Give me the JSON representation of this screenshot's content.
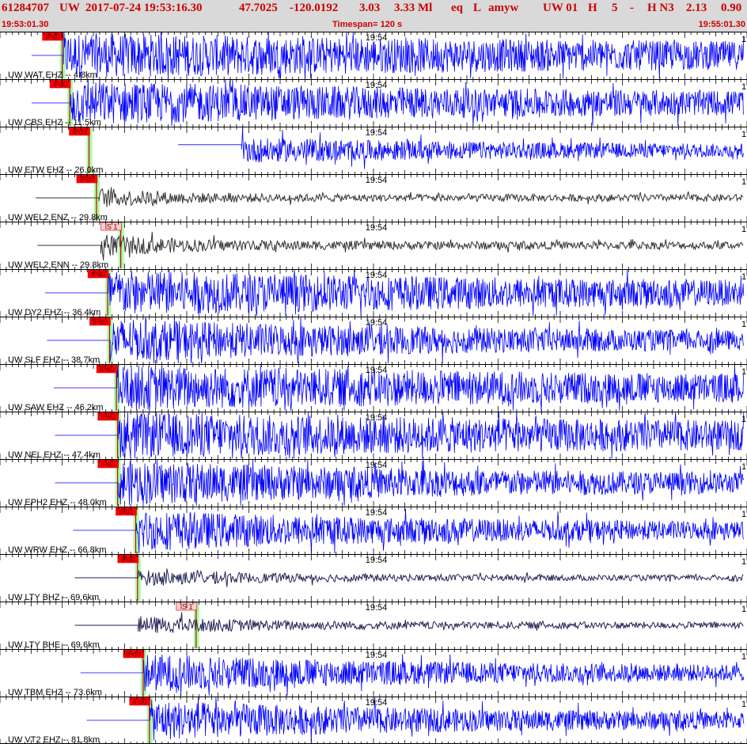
{
  "header": {
    "event_id": "61284707",
    "network": "UW",
    "datetime": "2017-07-24 19:53:16.30",
    "latitude": "47.7025",
    "longitude": "-120.0192",
    "depth": "3.03",
    "magnitude": "3.33 Ml",
    "event_type": "eq",
    "location_flag": "L",
    "analyst": "amyw",
    "solution_source": "UW 01",
    "quality": "H",
    "phase_count": "5",
    "dash": "-",
    "review_code": "H N3",
    "value_a": "2.13",
    "value_b": "0.90",
    "start_time": "19:53:01.30",
    "timespan_label": "Timespan= 120 s",
    "end_time": "19:55:01.30"
  },
  "chart_data": {
    "type": "seismogram",
    "time_start": "19:53:01.30",
    "time_end": "19:55:01.30",
    "timespan_s": 120,
    "minute_marker": "19:54",
    "minute_marker_offset_s": 58.7,
    "scale_label": "1",
    "colors": {
      "trace_blue": "#0000ff",
      "trace_dark": "#333333",
      "trace_navy": "#222255",
      "pick_label_bg": "#ff0000",
      "s_pick_label_bg": "#ffcccc",
      "pick_line": "#cc0000",
      "pick_window": "#99ff99",
      "header_bg": "#d9d9d9",
      "header_text": "#cc0000"
    },
    "channels": [
      {
        "label": "UW WAT EHZ -- 4.8km",
        "color": "blue",
        "onset_s": 10.2,
        "amplitude": 1.0,
        "decay": 0.4,
        "pre_offset": 0.0,
        "picks": [
          {
            "label": "iPd0",
            "time_s": 10.0
          }
        ]
      },
      {
        "label": "UW CBS EHZ -- 11.5km",
        "color": "blue",
        "onset_s": 11.3,
        "amplitude": 0.95,
        "decay": 0.5,
        "pre_offset": 0.0,
        "picks": [
          {
            "label": "iPd0",
            "time_s": 11.2
          }
        ]
      },
      {
        "label": "UW ETW EHZ -- 26.0km",
        "color": "blue",
        "onset_s": 38.8,
        "amplitude": 0.55,
        "decay": 0.6,
        "pre_offset": 0.25,
        "picks": [
          {
            "label": "iPd0",
            "time_s": 14.3
          }
        ]
      },
      {
        "label": "UW WEL2 ENZ -- 29.8km",
        "color": "dark",
        "onset_s": 15.9,
        "amplitude": 0.45,
        "decay": 4.0,
        "pre_offset": 0.0,
        "picks": [
          {
            "label": "iPd0",
            "time_s": 15.5
          }
        ]
      },
      {
        "label": "UW WEL2 ENN -- 29.8km",
        "color": "dark",
        "onset_s": 16.2,
        "amplitude": 0.5,
        "decay": 3.5,
        "pre_offset": 0.0,
        "picks": [
          {
            "label": "iS 1",
            "time_s": 19.4
          }
        ]
      },
      {
        "label": "UW DY2 EHZ -- 36.4km",
        "color": "blue",
        "onset_s": 17.4,
        "amplitude": 1.0,
        "decay": 0.5,
        "pre_offset": 0.0,
        "picks": [
          {
            "label": "iPd0",
            "time_s": 17.3
          }
        ]
      },
      {
        "label": "UW SLF EHZ -- 38.7km",
        "color": "blue",
        "onset_s": 17.7,
        "amplitude": 0.95,
        "decay": 0.8,
        "pre_offset": 0.0,
        "picks": [
          {
            "label": "iPd0",
            "time_s": 17.6
          }
        ]
      },
      {
        "label": "UW SAW EHZ -- 46.2km",
        "color": "blue",
        "onset_s": 18.8,
        "amplitude": 1.0,
        "decay": 0.4,
        "pre_offset": 0.0,
        "picks": [
          {
            "label": "iPd0",
            "time_s": 18.7
          }
        ]
      },
      {
        "label": "UW NEL EHZ -- 47.4km",
        "color": "blue",
        "onset_s": 19.0,
        "amplitude": 1.0,
        "decay": 0.35,
        "pre_offset": 0.0,
        "picks": [
          {
            "label": "iPd0",
            "time_s": 18.9
          }
        ]
      },
      {
        "label": "UW EPH2 EHZ -- 48.0km",
        "color": "blue",
        "onset_s": 19.0,
        "amplitude": 1.0,
        "decay": 0.8,
        "pre_offset": 0.0,
        "picks": [
          {
            "label": "iPd0",
            "time_s": 18.9
          }
        ]
      },
      {
        "label": "UW WRW EHZ -- 66.8km",
        "color": "blue",
        "onset_s": 21.9,
        "amplitude": 0.9,
        "decay": 0.9,
        "pre_offset": 0.0,
        "picks": [
          {
            "label": "iPd1",
            "time_s": 21.8
          }
        ]
      },
      {
        "label": "UW LTY BHZ -- 69.6km",
        "color": "navy",
        "onset_s": 22.2,
        "amplitude": 0.35,
        "decay": 2.0,
        "pre_offset": 0.0,
        "picks": [
          {
            "label": "iPd0",
            "time_s": 22.1
          }
        ]
      },
      {
        "label": "UW LTY BHE -- 69.6km",
        "color": "navy",
        "onset_s": 22.2,
        "amplitude": 0.4,
        "decay": 2.2,
        "pre_offset": 0.0,
        "picks": [
          {
            "label": "iS 1",
            "time_s": 31.5
          }
        ]
      },
      {
        "label": "UW TBM EHZ -- 73.6km",
        "color": "blue",
        "onset_s": 23.1,
        "amplitude": 0.85,
        "decay": 1.0,
        "pre_offset": 0.0,
        "picks": [
          {
            "label": "iPd0",
            "time_s": 23.0
          }
        ]
      },
      {
        "label": "UW VT2 EHZ -- 81.8km",
        "color": "blue",
        "onset_s": 24.1,
        "amplitude": 0.9,
        "decay": 1.0,
        "pre_offset": 0.0,
        "picks": [
          {
            "label": "iPd0",
            "time_s": 24.0
          }
        ]
      }
    ]
  }
}
